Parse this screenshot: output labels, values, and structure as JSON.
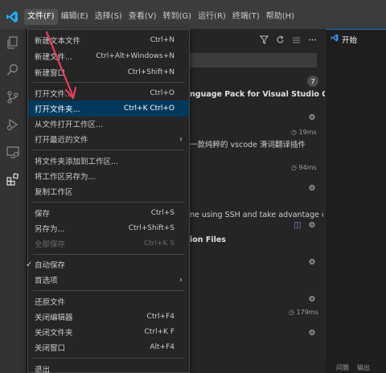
{
  "menubar": {
    "items": [
      {
        "label": "文件(F)",
        "active": true
      },
      {
        "label": "编辑(E)"
      },
      {
        "label": "选择(S)"
      },
      {
        "label": "查看(V)"
      },
      {
        "label": "转到(G)"
      },
      {
        "label": "运行(R)"
      },
      {
        "label": "终端(T)"
      },
      {
        "label": "帮助(H)"
      }
    ]
  },
  "file_menu": {
    "new_text_file": {
      "label": "新建文本文件",
      "shortcut": "Ctrl+N"
    },
    "new_file": {
      "label": "新建文件...",
      "shortcut": "Ctrl+Alt+Windows+N"
    },
    "new_window": {
      "label": "新建窗口",
      "shortcut": "Ctrl+Shift+N"
    },
    "open_file": {
      "label": "打开文件...",
      "shortcut": "Ctrl+O"
    },
    "open_folder": {
      "label": "打开文件夹...",
      "shortcut": "Ctrl+K Ctrl+O"
    },
    "open_workspace": {
      "label": "从文件打开工作区..."
    },
    "open_recent": {
      "label": "打开最近的文件"
    },
    "add_folder": {
      "label": "将文件夹添加到工作区..."
    },
    "save_workspace_as": {
      "label": "将工作区另存为..."
    },
    "duplicate_workspace": {
      "label": "复制工作区"
    },
    "save": {
      "label": "保存",
      "shortcut": "Ctrl+S"
    },
    "save_as": {
      "label": "另存为...",
      "shortcut": "Ctrl+Shift+S"
    },
    "save_all": {
      "label": "全部保存",
      "shortcut": "Ctrl+K S"
    },
    "auto_save": {
      "label": "自动保存",
      "checked": true
    },
    "preferences": {
      "label": "首选项"
    },
    "revert": {
      "label": "还原文件"
    },
    "close_editor": {
      "label": "关闭编辑器",
      "shortcut": "Ctrl+F4"
    },
    "close_folder": {
      "label": "关闭文件夹",
      "shortcut": "Ctrl+K F"
    },
    "close_window": {
      "label": "关闭窗口",
      "shortcut": "Alt+F4"
    },
    "exit": {
      "label": "退出"
    }
  },
  "extensions": {
    "badge_count": "7",
    "items": [
      {
        "title": "nguage Pack for Visual Studio Code",
        "time": "19ms"
      },
      {
        "desc": "一款纯粹的 vscode 滑词翻译插件",
        "time": "94ms"
      },
      {
        "desc": "ne using SSH and take advantage of ..."
      },
      {
        "title": "ion Files"
      },
      {
        "time": "179ms"
      }
    ]
  },
  "editor": {
    "tab_label": "开始"
  },
  "panel": {
    "tabs": [
      "问题",
      "输出"
    ]
  },
  "colors": {
    "accent": "#007acc",
    "selection": "#04395e",
    "menu_bg": "#252526",
    "annotation_arrow": "#e8405a"
  }
}
